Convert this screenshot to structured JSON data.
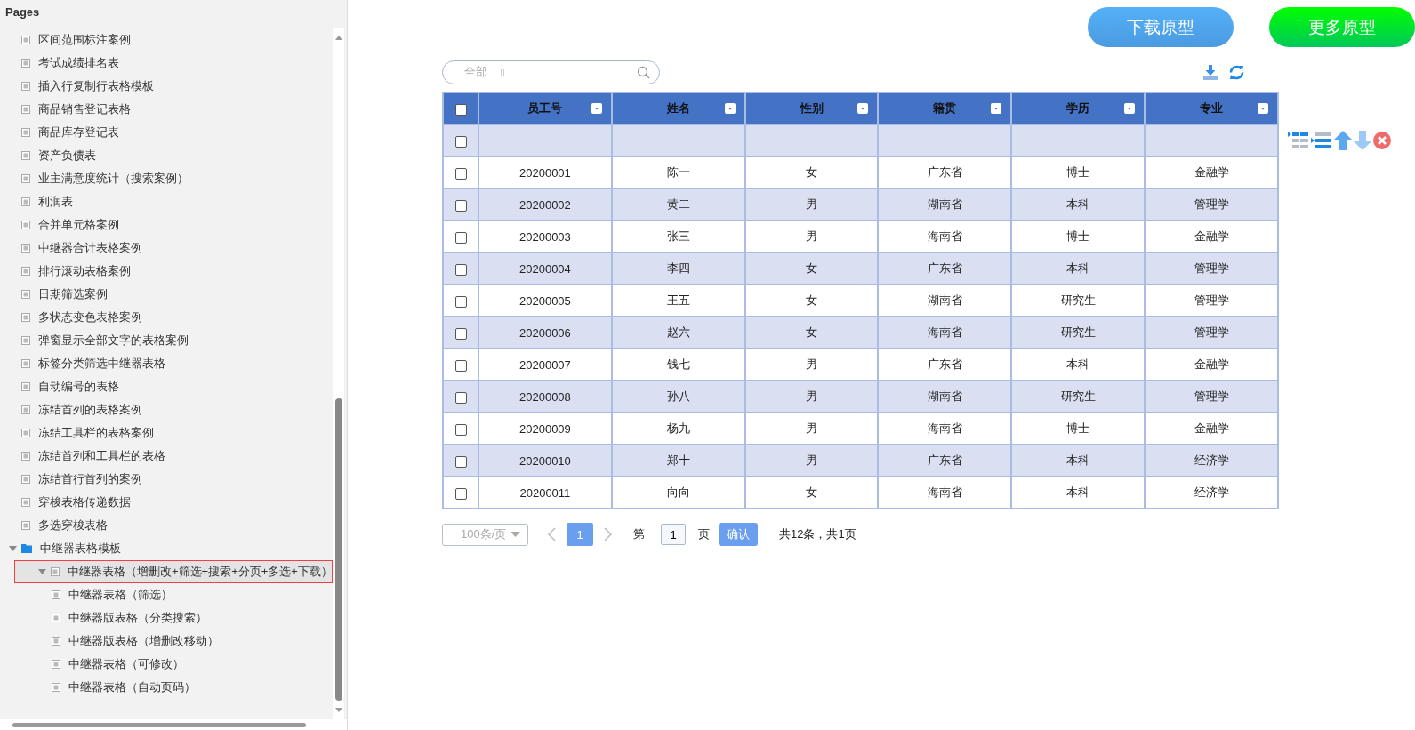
{
  "sidebar": {
    "title": "Pages",
    "items": [
      {
        "label": "区间范围标注案例",
        "kind": "page",
        "selected": false
      },
      {
        "label": "考试成绩排名表",
        "kind": "page",
        "selected": false
      },
      {
        "label": "插入行复制行表格模板",
        "kind": "page",
        "selected": false
      },
      {
        "label": "商品销售登记表格",
        "kind": "page",
        "selected": false
      },
      {
        "label": "商品库存登记表",
        "kind": "page",
        "selected": false
      },
      {
        "label": "资产负债表",
        "kind": "page",
        "selected": false
      },
      {
        "label": "业主满意度统计（搜索案例）",
        "kind": "page",
        "selected": false
      },
      {
        "label": "利润表",
        "kind": "page",
        "selected": false
      },
      {
        "label": "合并单元格案例",
        "kind": "page",
        "selected": false
      },
      {
        "label": "中继器合计表格案例",
        "kind": "page",
        "selected": false
      },
      {
        "label": "排行滚动表格案例",
        "kind": "page",
        "selected": false
      },
      {
        "label": "日期筛选案例",
        "kind": "page",
        "selected": false
      },
      {
        "label": "多状态变色表格案例",
        "kind": "page",
        "selected": false
      },
      {
        "label": "弹窗显示全部文字的表格案例",
        "kind": "page",
        "selected": false
      },
      {
        "label": "标签分类筛选中继器表格",
        "kind": "page",
        "selected": false
      },
      {
        "label": "自动编号的表格",
        "kind": "page",
        "selected": false
      },
      {
        "label": "冻结首列的表格案例",
        "kind": "page",
        "selected": false
      },
      {
        "label": "冻结工具栏的表格案例",
        "kind": "page",
        "selected": false
      },
      {
        "label": "冻结首列和工具栏的表格",
        "kind": "page",
        "selected": false
      },
      {
        "label": "冻结首行首列的案例",
        "kind": "page",
        "selected": false
      },
      {
        "label": "穿梭表格传递数据",
        "kind": "page",
        "selected": false
      },
      {
        "label": "多选穿梭表格",
        "kind": "page",
        "selected": false
      },
      {
        "label": "中继器表格模板",
        "kind": "folder",
        "selected": false,
        "expanded": true,
        "children": [
          {
            "label": "中继器表格（增删改+筛选+搜索+分页+多选+下载）",
            "kind": "page",
            "selected": true,
            "expanded": true,
            "children": [
              {
                "label": "中继器表格（筛选）",
                "kind": "page",
                "selected": false
              },
              {
                "label": "中继器版表格（分类搜索）",
                "kind": "page",
                "selected": false
              },
              {
                "label": "中继器版表格（增删改移动）",
                "kind": "page",
                "selected": false
              },
              {
                "label": "中继器表格（可修改）",
                "kind": "page",
                "selected": false
              },
              {
                "label": "中继器表格（自动页码）",
                "kind": "page",
                "selected": false
              }
            ]
          }
        ]
      }
    ]
  },
  "top_buttons": [
    {
      "label": "下载原型",
      "kind": "blue"
    },
    {
      "label": "更多原型",
      "kind": "green"
    }
  ],
  "search": {
    "category": "全部",
    "glyph": "▯"
  },
  "table": {
    "header_checked": false,
    "columns": [
      "员工号",
      "姓名",
      "性别",
      "籍贯",
      "学历",
      "专业"
    ],
    "filter_row": {
      "checked": false
    },
    "rows": [
      {
        "checked": false,
        "cells": [
          "20200001",
          "陈一",
          "女",
          "广东省",
          "博士",
          "金融学"
        ]
      },
      {
        "checked": false,
        "cells": [
          "20200002",
          "黄二",
          "男",
          "湖南省",
          "本科",
          "管理学"
        ]
      },
      {
        "checked": false,
        "cells": [
          "20200003",
          "张三",
          "男",
          "海南省",
          "博士",
          "金融学"
        ]
      },
      {
        "checked": false,
        "cells": [
          "20200004",
          "李四",
          "女",
          "广东省",
          "本科",
          "管理学"
        ]
      },
      {
        "checked": false,
        "cells": [
          "20200005",
          "王五",
          "女",
          "湖南省",
          "研究生",
          "管理学"
        ]
      },
      {
        "checked": false,
        "cells": [
          "20200006",
          "赵六",
          "女",
          "海南省",
          "研究生",
          "管理学"
        ]
      },
      {
        "checked": false,
        "cells": [
          "20200007",
          "钱七",
          "男",
          "广东省",
          "本科",
          "金融学"
        ]
      },
      {
        "checked": false,
        "cells": [
          "20200008",
          "孙八",
          "男",
          "湖南省",
          "研究生",
          "管理学"
        ]
      },
      {
        "checked": false,
        "cells": [
          "20200009",
          "杨九",
          "男",
          "海南省",
          "博士",
          "金融学"
        ]
      },
      {
        "checked": false,
        "cells": [
          "20200010",
          "郑十",
          "男",
          "广东省",
          "本科",
          "经济学"
        ]
      },
      {
        "checked": false,
        "cells": [
          "20200011",
          "向向",
          "女",
          "海南省",
          "本科",
          "经济学"
        ]
      }
    ]
  },
  "pagination": {
    "page_size": "100条/页",
    "pages": [
      {
        "label": "1",
        "selected": true
      }
    ],
    "page_prefix": "第",
    "page_input": "1",
    "page_suffix": "页",
    "confirm": "确认",
    "summary": "共12条，共1页"
  }
}
